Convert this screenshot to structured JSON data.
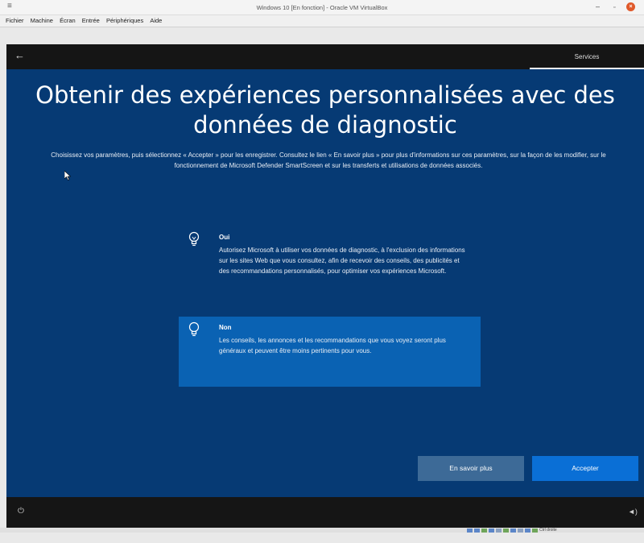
{
  "window": {
    "title": "Windows 10 [En fonction] - Oracle VM VirtualBox",
    "minimize_glyph": "–",
    "maximize_glyph": "▫",
    "close_glyph": "×",
    "menu_glyph": "≡"
  },
  "menubar": {
    "items": [
      "Fichier",
      "Machine",
      "Écran",
      "Entrée",
      "Périphériques",
      "Aide"
    ]
  },
  "guest": {
    "topbar": {
      "back_icon": "arrow-left-icon",
      "tab": "Services"
    },
    "heading": "Obtenir des expériences personnalisées avec des données de diagnostic",
    "description": "Choisissez vos paramètres, puis sélectionnez « Accepter » pour les enregistrer. Consultez le lien « En savoir plus » pour plus d'informations sur ces paramètres, sur la façon de les modifier, sur le fonctionnement de Microsoft Defender SmartScreen et sur les transferts et utilisations de données associés.",
    "options": [
      {
        "title": "Oui",
        "text": "Autorisez Microsoft à utiliser vos données de diagnostic, à l'exclusion des informations sur les sites Web que vous consultez, afin de recevoir des conseils, des publicités et des recommandations personnalisés, pour optimiser vos expériences Microsoft.",
        "icon": "lightbulb-on-icon",
        "selected": false
      },
      {
        "title": "Non",
        "text": "Les conseils, les annonces et les recommandations que vous voyez seront plus généraux et peuvent être moins pertinents pour vous.",
        "icon": "lightbulb-icon",
        "selected": true
      }
    ],
    "buttons": {
      "learn_more": "En savoir plus",
      "accept": "Accepter"
    },
    "bottombar": {
      "power_icon": "power-icon",
      "volume_icon": "volume-icon"
    }
  },
  "colors": {
    "oobe_background": "#063a74",
    "selected_option": "#0a62b3",
    "accept_button": "#0a6fd6",
    "secondary_button": "#3d6a97",
    "bars": "#151515"
  },
  "statusbar": {
    "text": "Ctrl droite"
  }
}
